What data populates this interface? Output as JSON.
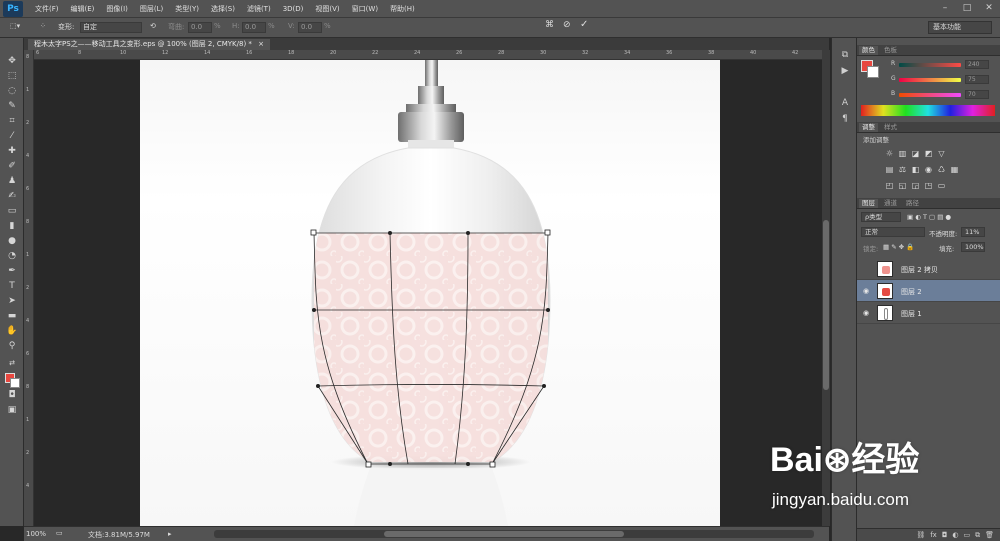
{
  "app": {
    "logo": "Ps"
  },
  "menu": [
    "文件(F)",
    "编辑(E)",
    "图像(I)",
    "图层(L)",
    "类型(Y)",
    "选择(S)",
    "滤镜(T)",
    "3D(D)",
    "视图(V)",
    "窗口(W)",
    "帮助(H)"
  ],
  "options": {
    "transform_label": "变形:",
    "transform_value": "自定",
    "bend_label": "弯曲:",
    "bend_value": "0.0",
    "bend_unit": "%",
    "h_label": "H:",
    "h_value": "0.0",
    "h_unit": "%",
    "v_label": "V:",
    "v_value": "0.0",
    "v_unit": "%",
    "workspace": "基本功能"
  },
  "document": {
    "tab_title": "程木太字PS之——移动工具之变形.eps @ 100% (图层 2, CMYK/8) *"
  },
  "ruler": {
    "top_ticks": [
      "6",
      "8",
      "10",
      "12",
      "14",
      "16",
      "18",
      "20",
      "22",
      "24",
      "26",
      "28",
      "30",
      "32",
      "34",
      "36",
      "38",
      "40",
      "42"
    ],
    "left_ticks": [
      "8",
      "1",
      "2",
      "4",
      "6",
      "8",
      "1",
      "2",
      "4",
      "6",
      "8",
      "1",
      "2",
      "4"
    ]
  },
  "status": {
    "zoom": "100%",
    "doc_size": "文档:3.81M/5.97M"
  },
  "color_panel": {
    "tabs": [
      "颜色",
      "色板"
    ],
    "sliders": [
      {
        "label": "R",
        "value": "240"
      },
      {
        "label": "G",
        "value": "75"
      },
      {
        "label": "B",
        "value": "70"
      }
    ],
    "colors": {
      "fg": "#e8473f",
      "bg": "#ffffff"
    }
  },
  "adjust_panel": {
    "tabs": [
      "调整",
      "样式"
    ],
    "title": "添加调整"
  },
  "layers_panel": {
    "tabs": [
      "图层",
      "通道",
      "路径"
    ],
    "filter_label": "ρ类型",
    "blend_mode": "正常",
    "opacity_label": "不透明度:",
    "opacity_value": "11%",
    "lock_label": "锁定:",
    "fill_label": "填充:",
    "fill_value": "100%",
    "layers": [
      {
        "name": "图层 2 拷贝",
        "visible": false,
        "selected": false
      },
      {
        "name": "图层 2",
        "visible": true,
        "selected": true
      },
      {
        "name": "图层 1",
        "visible": true,
        "selected": false
      }
    ]
  },
  "watermark": {
    "logo": "Bai⊛经验",
    "url": "jingyan.baidu.com"
  }
}
